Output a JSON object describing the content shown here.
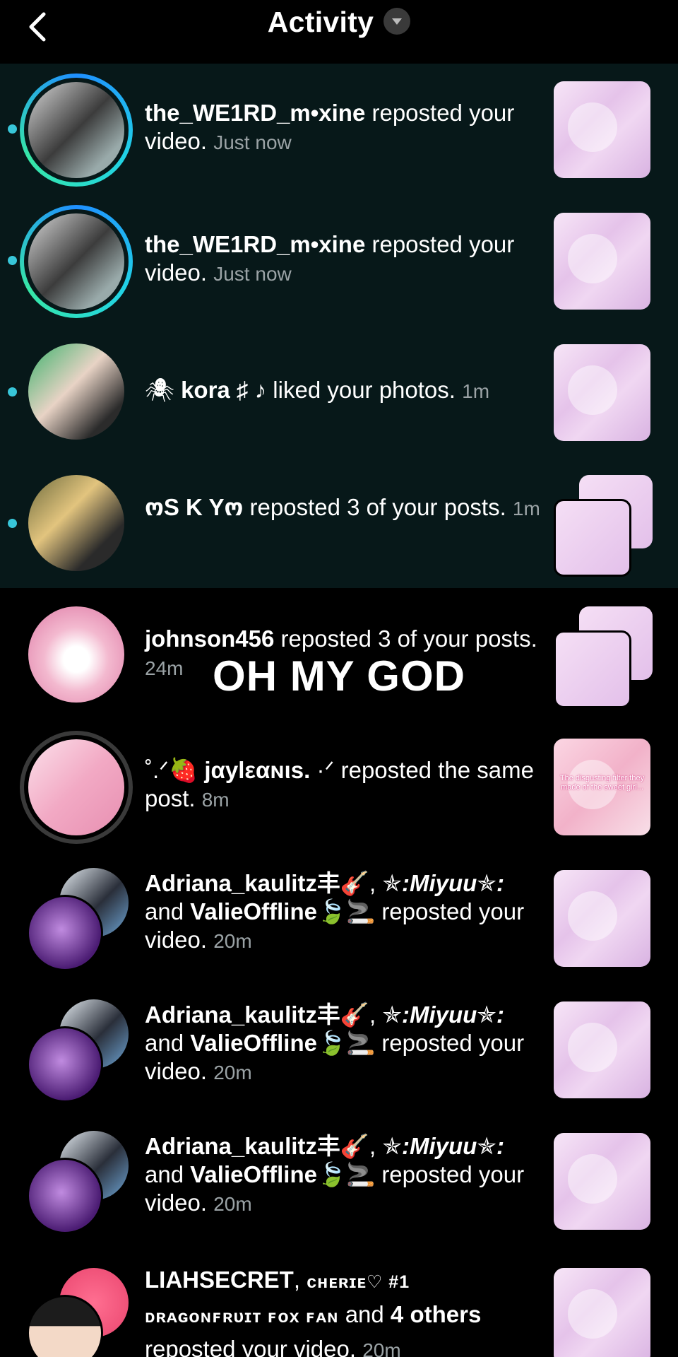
{
  "header": {
    "title": "Activity"
  },
  "overlay_caption": "OH MY GOD",
  "notifications": [
    {
      "user": "the_WE1RD_m•xine",
      "action": "reposted your video.",
      "time": "Just now",
      "unread": true
    },
    {
      "user": "the_WE1RD_m•xine",
      "action": "reposted your video.",
      "time": "Just now",
      "unread": true
    },
    {
      "user_prefix": "🕷",
      "user": "kora ♯ ♪",
      "action": "liked your photos.",
      "time": "1m",
      "unread": true
    },
    {
      "user": "ოS K Yო",
      "action": "reposted 3 of your posts.",
      "time": "1m",
      "unread": true
    },
    {
      "user": "johnson456",
      "action": "reposted 3 of your posts.",
      "time": "24m",
      "unread": false
    },
    {
      "user_prefix": "˚.ᐟ🍓",
      "user": "jαylεαɴιs.",
      "user_suffix": "·ᐟ",
      "action": "reposted the same post.",
      "time": "8m",
      "unread": false,
      "thumb_text": "The disgusting filter they made of the sweet girl..."
    },
    {
      "users": [
        "Adriana_kaulitz丰🎸",
        "✯:Miyuu✯:",
        "ValieOffline🍃🚬"
      ],
      "action": "reposted your video.",
      "time": "20m",
      "unread": false
    },
    {
      "users": [
        "Adriana_kaulitz丰🎸",
        "✯:Miyuu✯:",
        "ValieOffline🍃🚬"
      ],
      "action": "reposted your video.",
      "time": "20m",
      "unread": false
    },
    {
      "users": [
        "Adriana_kaulitz丰🎸",
        "✯:Miyuu✯:",
        "ValieOffline🍃🚬"
      ],
      "action": "reposted your video.",
      "time": "20m",
      "unread": false
    },
    {
      "users": [
        "LIAHSECRET",
        "ᴄʜᴇʀɪᴇ♡ #1",
        "ᴅʀᴀɢᴏɴꜰʀᴜɪᴛ ꜰᴏx ꜰᴀɴ"
      ],
      "others": "4 others",
      "action": "reposted your video.",
      "time": "20m",
      "unread": false
    }
  ],
  "connectors": {
    "and": "and",
    "comma": ", "
  }
}
